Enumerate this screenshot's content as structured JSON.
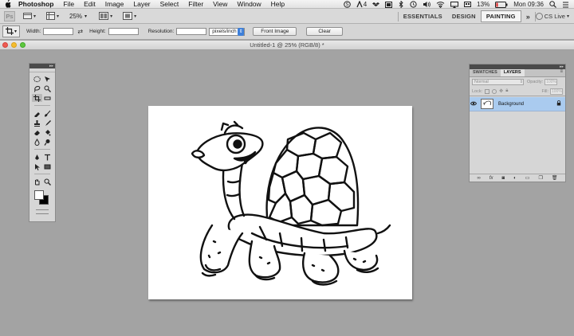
{
  "menubar": {
    "app_name": "Photoshop",
    "items": [
      "File",
      "Edit",
      "Image",
      "Layer",
      "Select",
      "Filter",
      "View",
      "Window",
      "Help"
    ],
    "status": {
      "adobe_badge": "4",
      "battery": "13%",
      "clock": "Mon 09:36"
    }
  },
  "appbar": {
    "logo": "Ps",
    "zoom": "25%",
    "workspaces": [
      "ESSENTIALS",
      "DESIGN",
      "PAINTING"
    ],
    "active_workspace": "PAINTING",
    "more": "»",
    "cslive": "CS Live"
  },
  "options": {
    "width_label": "Width:",
    "height_label": "Height:",
    "resolution_label": "Resolution:",
    "units": "pixels/inch",
    "front_image": "Front Image",
    "clear": "Clear"
  },
  "document": {
    "title": "Untitled-1 @ 25% (RGB/8) *"
  },
  "layers_panel": {
    "tabs": [
      "SWATCHES",
      "LAYERS"
    ],
    "active_tab": "LAYERS",
    "blend_mode": "Normal",
    "opacity_label": "Opacity:",
    "opacity_value": "100%",
    "lock_label": "Lock:",
    "fill_label": "Fill:",
    "fill_value": "100%",
    "layer_name": "Background"
  },
  "colors": {
    "selected_layer": "#aacbef",
    "dropdown_blue": "#3d7fd9",
    "workspace_bg": "#a3a3a3"
  }
}
